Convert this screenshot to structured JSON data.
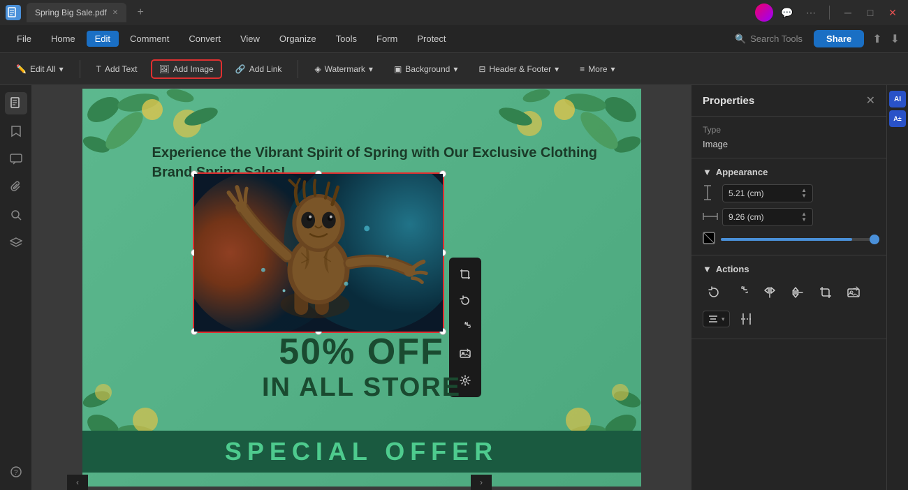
{
  "titleBar": {
    "logo": "PDF",
    "tab": {
      "filename": "Spring Big Sale.pdf",
      "modified": true
    },
    "windowControls": {
      "minimize": "─",
      "maximize": "□",
      "close": "✕"
    }
  },
  "menuBar": {
    "items": [
      "File",
      "Home",
      "Edit",
      "Comment",
      "Convert",
      "View",
      "Organize",
      "Tools",
      "Form",
      "Protect"
    ],
    "activeItem": "Edit",
    "searchTools": "Search Tools",
    "shareButton": "Share"
  },
  "toolbar": {
    "editAll": "Edit All",
    "addText": "Add Text",
    "addImage": "Add Image",
    "addLink": "Add Link",
    "watermark": "Watermark",
    "background": "Background",
    "headerFooter": "Header & Footer",
    "more": "More"
  },
  "canvas": {
    "heading": "Experience the Vibrant Spirit of Spring with Our Exclusive Clothing Brand Spring Sales!",
    "salePercent": "50% OFF",
    "saleStore": "IN ALL STORE",
    "specialOffer": "SPECIAL OFFER"
  },
  "properties": {
    "panelTitle": "Properties",
    "typeLabel": "Type",
    "typeValue": "Image",
    "appearanceLabel": "Appearance",
    "heightLabel": "height",
    "heightValue": "5.21 (cm)",
    "widthLabel": "width",
    "widthValue": "9.26 (cm)",
    "actionsLabel": "Actions",
    "sliderValue": 85
  },
  "floatToolbar": {
    "crop": "⊠",
    "rotateLeft": "↺",
    "rotateRight": "↻",
    "replace": "⊞",
    "settings": "⚙"
  },
  "sidebarIcons": [
    "pages-icon",
    "bookmarks-icon",
    "comments-icon",
    "attachments-icon",
    "search-icon",
    "layers-icon"
  ]
}
